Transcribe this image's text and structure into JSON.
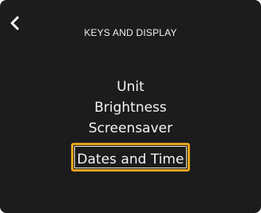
{
  "screen": {
    "title": "KEYS AND DISPLAY",
    "back_icon": "chevron-left-icon"
  },
  "menu": {
    "items": [
      {
        "label": "Unit"
      },
      {
        "label": "Brightness"
      },
      {
        "label": "Screensaver"
      },
      {
        "label": "Dates and Time",
        "selected": true
      }
    ]
  },
  "colors": {
    "background": "#1c1c1c",
    "text": "#f4f4f4",
    "selection_border": "#e4a21f"
  }
}
